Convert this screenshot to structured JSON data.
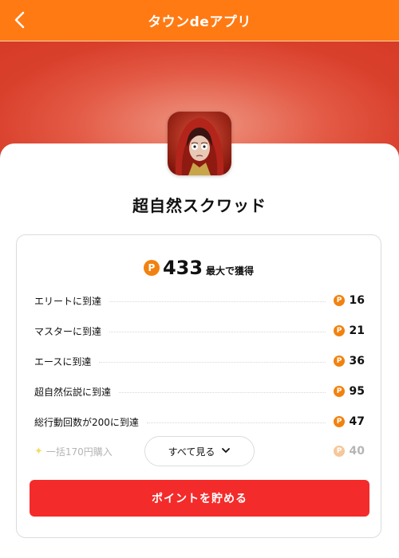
{
  "header": {
    "title": "タウンdeアプリ"
  },
  "app": {
    "name": "超自然スクワッド"
  },
  "points": {
    "coin_glyph": "P",
    "total": "433",
    "total_suffix": "最大で獲得"
  },
  "rewards": [
    {
      "label": "エリートに到達",
      "points": "16"
    },
    {
      "label": "マスターに到達",
      "points": "21"
    },
    {
      "label": "エースに到達",
      "points": "36"
    },
    {
      "label": "超自然伝説に到達",
      "points": "95"
    },
    {
      "label": "総行動回数が200に到達",
      "points": "47"
    },
    {
      "label": "一括170円購入",
      "points": "40",
      "faded": true
    }
  ],
  "see_all_label": "すべて見る",
  "cta_label": "ポイントを貯める",
  "colors": {
    "header": "#ff7a12",
    "coin": "#f2820f",
    "cta": "#f42b2b"
  }
}
